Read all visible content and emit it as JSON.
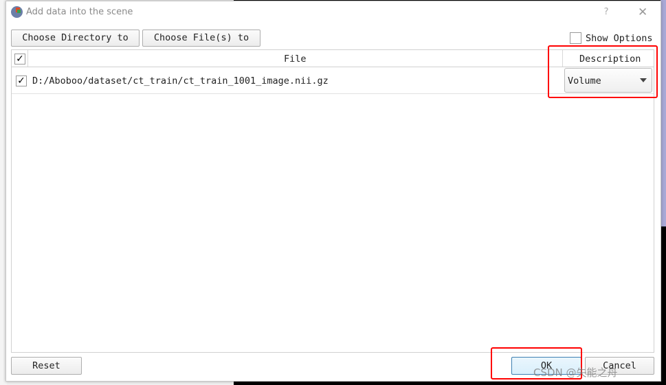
{
  "dialog": {
    "title": "Add data into the scene",
    "help_label": "?",
    "close_label": "✕"
  },
  "toolbar": {
    "choose_directory_label": "Choose Directory to Add",
    "choose_files_label": "Choose File(s) to Add",
    "show_options_label": "Show Options",
    "show_options_checked": false
  },
  "table": {
    "columns": [
      "File",
      "Description"
    ],
    "select_all_checked": true,
    "rows": [
      {
        "checked": true,
        "file": "D:/Aboboo/dataset/ct_train/ct_train_1001_image.nii.gz",
        "description": "Volume"
      }
    ]
  },
  "footer": {
    "reset_label": "Reset",
    "ok_label": "OK",
    "cancel_label": "Cancel"
  },
  "watermark": "CSDN @失能之舟",
  "colors": {
    "highlight": "#ff0000"
  }
}
